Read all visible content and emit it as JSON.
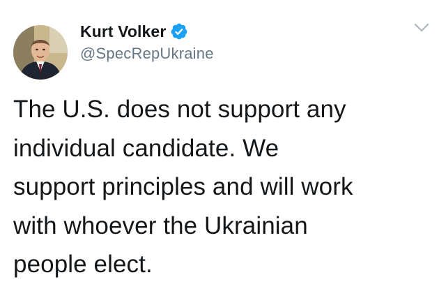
{
  "tweet": {
    "author": {
      "display_name": "Kurt Volker",
      "handle": "@SpecRepUkraine",
      "verified": true,
      "avatar_icon": "profile-photo"
    },
    "menu_icon": "chevron-down-icon",
    "text_lines": [
      "The U.S. does not support any",
      "individual candidate. We",
      "support principles and will work",
      "with whoever the Ukrainian",
      "people elect."
    ]
  },
  "colors": {
    "text": "#14171a",
    "secondary": "#657786",
    "verified_badge": "#1da1f2",
    "caret": "#aab8c2"
  }
}
